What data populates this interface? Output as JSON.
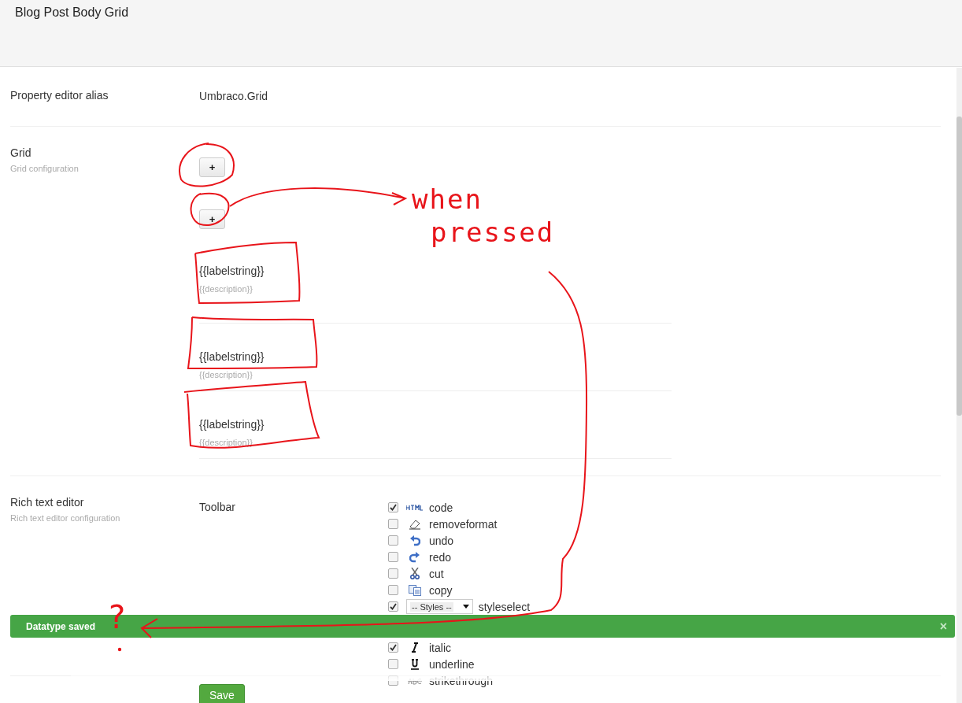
{
  "header": {
    "title": "Blog Post Body Grid"
  },
  "alias": {
    "label": "Property editor alias",
    "value": "Umbraco.Grid"
  },
  "grid": {
    "label": "Grid",
    "description": "Grid configuration",
    "add_buttons": [
      "+",
      "+"
    ],
    "items": [
      {
        "label": "{{labelstring}}",
        "description": "{{description}}"
      },
      {
        "label": "{{labelstring}}",
        "description": "{{description}}"
      },
      {
        "label": "{{labelstring}}",
        "description": "{{description}}"
      }
    ]
  },
  "rte": {
    "label": "Rich text editor",
    "description": "Rich text editor configuration",
    "toolbar_label": "Toolbar",
    "items": [
      {
        "kind": "icon",
        "label": "code",
        "checked": true
      },
      {
        "kind": "icon",
        "label": "removeformat",
        "checked": false
      },
      {
        "kind": "icon",
        "label": "undo",
        "checked": false
      },
      {
        "kind": "icon",
        "label": "redo",
        "checked": false
      },
      {
        "kind": "icon",
        "label": "cut",
        "checked": false
      },
      {
        "kind": "icon",
        "label": "copy",
        "checked": false
      },
      {
        "kind": "select",
        "label": "styleselect",
        "checked": true,
        "select_value": "-- Styles --"
      },
      {
        "kind": "icon",
        "label": "italic",
        "checked": true
      },
      {
        "kind": "icon",
        "label": "underline",
        "checked": false
      },
      {
        "kind": "icon",
        "label": "strikethrough",
        "checked": false
      }
    ]
  },
  "save_button": "Save",
  "notification": {
    "message": "Datatype saved",
    "close": "×"
  },
  "annotation": {
    "note": "when pressed",
    "mark": "?"
  }
}
